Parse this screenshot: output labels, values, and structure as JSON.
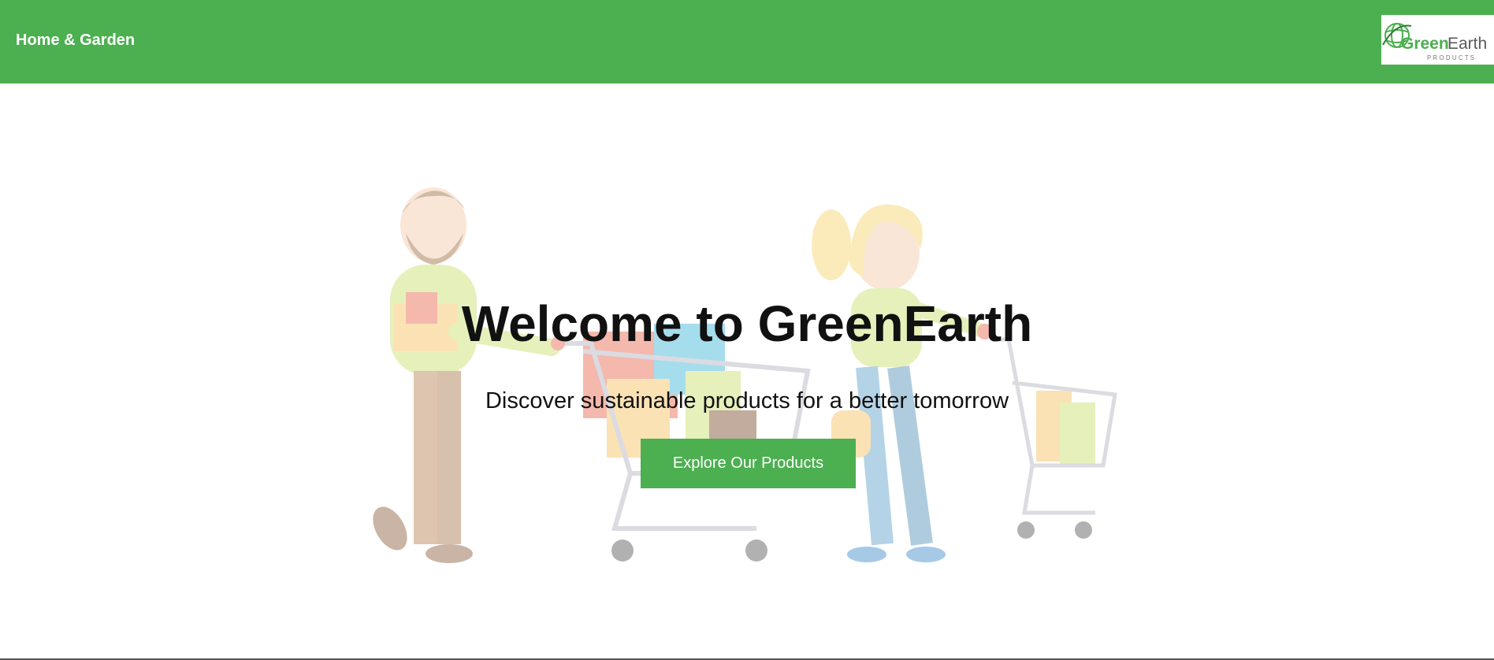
{
  "header": {
    "brand_label": "Home & Garden",
    "logo_text_green": "Green",
    "logo_text_gray": "Earth",
    "logo_tagline": "P R O D U C T S"
  },
  "hero": {
    "title": "Welcome to GreenEarth",
    "subtitle": "Discover sustainable products for a better tomorrow",
    "cta_label": "Explore Our Products",
    "illustration_icon": "shoppers-with-carts-illustration"
  },
  "colors": {
    "brand_green": "#4caf50",
    "text_dark": "#111111",
    "background": "#ffffff"
  }
}
